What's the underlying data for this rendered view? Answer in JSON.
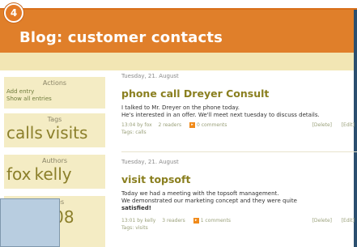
{
  "step_badge": "4",
  "blog": {
    "title": "Blog: customer contacts"
  },
  "sidebar": {
    "actions": {
      "title": "Actions",
      "links": [
        "Add entry",
        "Show all entries"
      ]
    },
    "tags": {
      "title": "Tags",
      "words": [
        "calls",
        "visits"
      ]
    },
    "authors": {
      "title": "Authors",
      "words": [
        "fox",
        "kelly"
      ]
    },
    "dates": {
      "title": "Dates",
      "partial": "2007-08"
    }
  },
  "posts": [
    {
      "date": "Tuesday, 21. August",
      "title": "phone call Dreyer Consult",
      "body": [
        "I talked to Mr. Dreyer on the phone today.",
        "He's interested in an offer. We'll meet next tuesday to discuss details."
      ],
      "meta": {
        "time_author": "13:04 by fox",
        "readers": "2 readers",
        "comments": "0 comments",
        "delete": "[Delete]",
        "edit": "[Edit]"
      },
      "tags": "Tags: calls"
    },
    {
      "date": "Tuesday, 21. August",
      "title": "visit topsoft",
      "body": [
        "Today we had a meeting with the topsoft management.",
        "We demonstrated our marketing concept and they were quite"
      ],
      "body_bold": "satisfied!",
      "meta": {
        "time_author": "13:01 by kelly",
        "readers": "3 readers",
        "comments": "1 comments",
        "delete": "[Delete]",
        "edit": "[Edit]"
      },
      "tags": "Tags: visits"
    }
  ]
}
